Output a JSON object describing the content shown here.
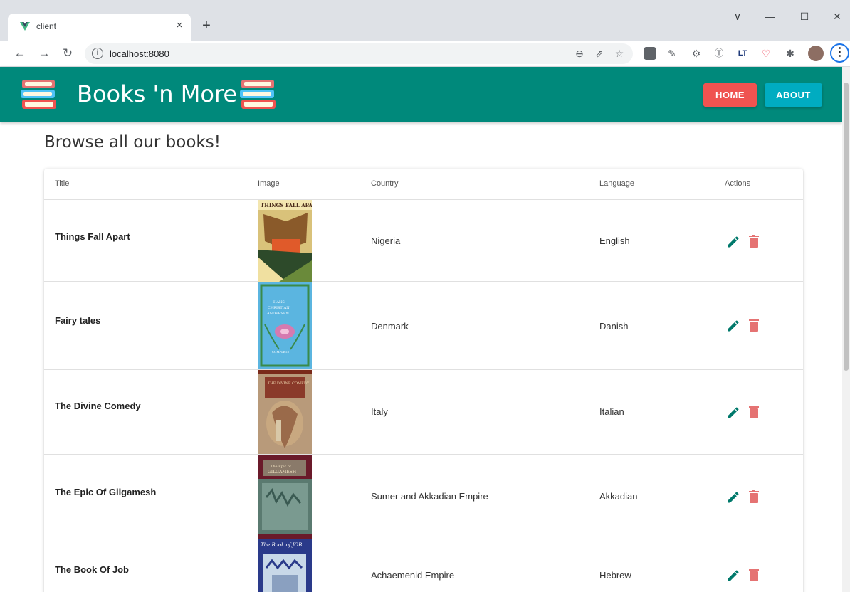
{
  "browser": {
    "tab_title": "client",
    "tab_close": "×",
    "new_tab": "+",
    "url": "localhost:8080",
    "win_min": "—",
    "win_max": "☐",
    "win_close": "✕",
    "win_collapse": "∨"
  },
  "app": {
    "title": "Books 'n More",
    "nav": {
      "home": "HOME",
      "about": "ABOUT"
    },
    "colors": {
      "header": "#00897b",
      "home": "#ef5350",
      "about": "#00acc1",
      "edit": "#00796b",
      "delete": "#e57373"
    }
  },
  "page": {
    "heading": "Browse all our books!"
  },
  "table": {
    "headers": {
      "title": "Title",
      "image": "Image",
      "country": "Country",
      "language": "Language",
      "actions": "Actions"
    },
    "rows": [
      {
        "title": "Things Fall Apart",
        "country": "Nigeria",
        "language": "English"
      },
      {
        "title": "Fairy tales",
        "country": "Denmark",
        "language": "Danish"
      },
      {
        "title": "The Divine Comedy",
        "country": "Italy",
        "language": "Italian"
      },
      {
        "title": "The Epic Of Gilgamesh",
        "country": "Sumer and Akkadian Empire",
        "language": "Akkadian"
      },
      {
        "title": "The Book Of Job",
        "country": "Achaemenid Empire",
        "language": "Hebrew"
      }
    ]
  }
}
